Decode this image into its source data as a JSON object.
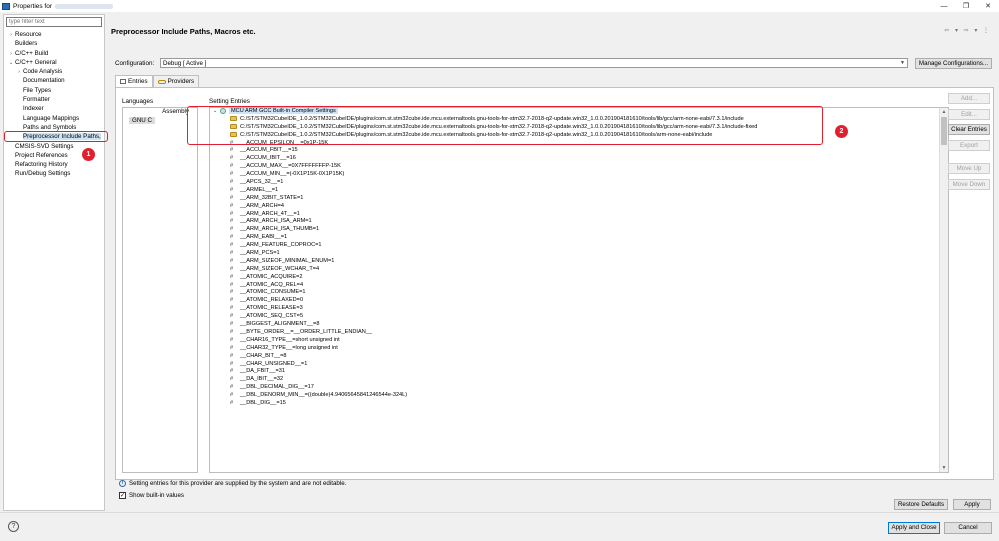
{
  "window": {
    "title": "Properties for",
    "controls": [
      "minimize",
      "restore",
      "close"
    ]
  },
  "left": {
    "filter_placeholder": "type filter text",
    "tree": [
      {
        "label": "Resource",
        "arrow": "›",
        "indent": 0
      },
      {
        "label": "Builders",
        "arrow": "",
        "indent": 0
      },
      {
        "label": "C/C++ Build",
        "arrow": "›",
        "indent": 0
      },
      {
        "label": "C/C++ General",
        "arrow": "⌄",
        "indent": 0
      },
      {
        "label": "Code Analysis",
        "arrow": "›",
        "indent": 1
      },
      {
        "label": "Documentation",
        "arrow": "",
        "indent": 1
      },
      {
        "label": "File Types",
        "arrow": "",
        "indent": 1
      },
      {
        "label": "Formatter",
        "arrow": "",
        "indent": 1
      },
      {
        "label": "Indexer",
        "arrow": "",
        "indent": 1
      },
      {
        "label": "Language Mappings",
        "arrow": "",
        "indent": 1
      },
      {
        "label": "Paths and Symbols",
        "arrow": "",
        "indent": 1
      },
      {
        "label": "Preprocessor Include Paths,",
        "arrow": "",
        "indent": 1,
        "selected": true
      },
      {
        "label": "CMSIS-SVD Settings",
        "arrow": "",
        "indent": 0
      },
      {
        "label": "Project References",
        "arrow": "",
        "indent": 0
      },
      {
        "label": "Refactoring History",
        "arrow": "",
        "indent": 0
      },
      {
        "label": "Run/Debug Settings",
        "arrow": "",
        "indent": 0
      }
    ]
  },
  "annotations": {
    "badge1": "1",
    "badge2": "2"
  },
  "main": {
    "title": "Preprocessor Include Paths, Macros etc.",
    "nav": "⇦ ▾ ⇨ ▾ ⋮",
    "configuration_label": "Configuration:",
    "configuration_value": "Debug  [ Active ]",
    "manage_button": "Manage Configurations...",
    "tabs": [
      {
        "label": "Entries"
      },
      {
        "label": "Providers"
      }
    ],
    "languages_label": "Languages",
    "languages": [
      {
        "label": "Assembly",
        "align": "right"
      },
      {
        "label": "GNU C",
        "chip": true
      }
    ],
    "setting_entries_label": "Setting Entries",
    "group": "MCU ARM GCC Built-in Compiler Settings",
    "includes": [
      "C:/ST/STM32CubeIDE_1.0.2/STM32CubeIDE/plugins/com.st.stm32cube.ide.mcu.externaltools.gnu-tools-for-stm32.7-2018-q2-update.win32_1.0.0.201904181610/tools/lib/gcc/arm-none-eabi/7.3.1/include",
      "C:/ST/STM32CubeIDE_1.0.2/STM32CubeIDE/plugins/com.st.stm32cube.ide.mcu.externaltools.gnu-tools-for-stm32.7-2018-q2-update.win32_1.0.0.201904181610/tools/lib/gcc/arm-none-eabi/7.3.1/include-fixed",
      "C:/ST/STM32CubeIDE_1.0.2/STM32CubeIDE/plugins/com.st.stm32cube.ide.mcu.externaltools.gnu-tools-for-stm32.7-2018-q2-update.win32_1.0.0.201904181610/tools/arm-none-eabi/include"
    ],
    "macros": [
      "__ACCUM_EPSILON__=0x1P-15K",
      "__ACCUM_FBIT__=15",
      "__ACCUM_IBIT__=16",
      "__ACCUM_MAX__=0X7FFFFFFFP-15K",
      "__ACCUM_MIN__=(-0X1P15K-0X1P15K)",
      "__APCS_32__=1",
      "__ARMEL__=1",
      "__ARM_32BIT_STATE=1",
      "__ARM_ARCH=4",
      "__ARM_ARCH_4T__=1",
      "__ARM_ARCH_ISA_ARM=1",
      "__ARM_ARCH_ISA_THUMB=1",
      "__ARM_EABI__=1",
      "__ARM_FEATURE_COPROC=1",
      "__ARM_PCS=1",
      "__ARM_SIZEOF_MINIMAL_ENUM=1",
      "__ARM_SIZEOF_WCHAR_T=4",
      "__ATOMIC_ACQUIRE=2",
      "__ATOMIC_ACQ_REL=4",
      "__ATOMIC_CONSUME=1",
      "__ATOMIC_RELAXED=0",
      "__ATOMIC_RELEASE=3",
      "__ATOMIC_SEQ_CST=5",
      "__BIGGEST_ALIGNMENT__=8",
      "__BYTE_ORDER__=__ORDER_LITTLE_ENDIAN__",
      "__CHAR16_TYPE__=short unsigned int",
      "__CHAR32_TYPE__=long unsigned int",
      "__CHAR_BIT__=8",
      "__CHAR_UNSIGNED__=1",
      "__DA_FBIT__=31",
      "__DA_IBIT__=32",
      "__DBL_DECIMAL_DIG__=17",
      "__DBL_DENORM_MIN__=((double)4.94065645841246544e-324L)",
      "__DBL_DIG__=15"
    ],
    "side_buttons": [
      {
        "label": "Add...",
        "enabled": false
      },
      {
        "label": "Edit...",
        "enabled": false
      },
      {
        "label": "Clear Entries",
        "enabled": true
      },
      {
        "label": "Export",
        "enabled": false
      },
      {
        "label": "Move Up",
        "enabled": false
      },
      {
        "label": "Move Down",
        "enabled": false
      }
    ],
    "info_text": "Setting entries for this provider are supplied by the system and are not editable.",
    "show_builtin_label": "Show built-in values",
    "show_builtin_checked": "✓",
    "restore_defaults": "Restore Defaults",
    "apply": "Apply"
  },
  "footer": {
    "apply_close": "Apply and Close",
    "cancel": "Cancel",
    "help": "?"
  }
}
